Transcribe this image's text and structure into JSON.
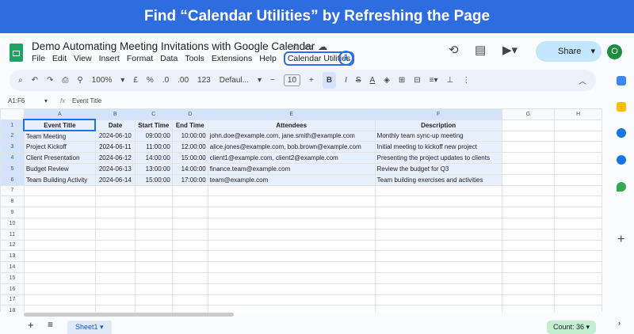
{
  "banner": "Find “Calendar Utilities” by Refreshing the Page",
  "doc_title": "Demo Automating Meeting Invitations with Google Calendar",
  "menu": [
    "File",
    "Edit",
    "View",
    "Insert",
    "Format",
    "Data",
    "Tools",
    "Extensions",
    "Help"
  ],
  "menu_highlight": "Calendar Utilities",
  "step_badge": "1",
  "share_label": "Share",
  "avatar": "O",
  "toolbar": {
    "zoom": "100%",
    "currency": "£",
    "percent": "%",
    "dec_less": ".0",
    "dec_more": ".00",
    "number_format": "123",
    "font": "Defaul...",
    "font_size": "10",
    "bold": "B",
    "italic": "I"
  },
  "name_box": "A1:F6",
  "formula": "Event Title",
  "columns": [
    "A",
    "B",
    "C",
    "D",
    "E",
    "F",
    "G",
    "H"
  ],
  "rows": [
    [
      "Event Title",
      "Date",
      "Start Time",
      "End Time",
      "Attendees",
      "Description"
    ],
    [
      "Team Meeting",
      "2024-06-10",
      "09:00:00",
      "10:00:00",
      "john.doe@example.com, jane.smith@example.com",
      "Monthly team sync-up meeting"
    ],
    [
      "Project Kickoff",
      "2024-06-11",
      "11:00:00",
      "12:00:00",
      "alice.jones@example.com, bob.brown@example.com",
      "Initial meeting to kickoff new project"
    ],
    [
      "Client Presentation",
      "2024-06-12",
      "14:00:00",
      "15:00:00",
      "client1@example.com, client2@example.com",
      "Presenting the project updates to clients"
    ],
    [
      "Budget Review",
      "2024-06-13",
      "13:00:00",
      "14:00:00",
      "finance.team@example.com",
      "Review the budget for Q3"
    ],
    [
      "Team Building Activity",
      "2024-06-14",
      "15:00:00",
      "17:00:00",
      "team@example.com",
      "Team building exercises and activities"
    ]
  ],
  "row_count": 18,
  "sheet_tab": "Sheet1",
  "count": "Count: 36",
  "colors": {
    "accent": "#2d6de0",
    "selection": "#e8f0fe"
  }
}
